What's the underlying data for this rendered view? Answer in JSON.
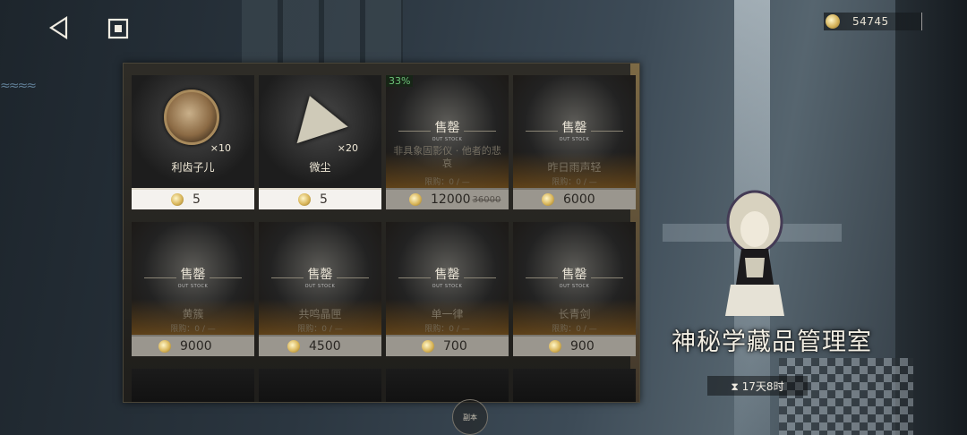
{
  "currency": {
    "amount": "54745",
    "icon": "coin-icon"
  },
  "shop": {
    "row1": [
      {
        "name": "利齿子儿",
        "qty": "×10",
        "price": "5",
        "sold_out": false
      },
      {
        "name": "微尘",
        "qty": "×20",
        "price": "5",
        "sold_out": false
      },
      {
        "name": "非具象固影仪 · 他者的悲哀",
        "price": "12000",
        "old_price": "36000",
        "discount": "33%",
        "limit": "限购：0 / —",
        "sold_out": true
      },
      {
        "name": "昨日雨声轻",
        "price": "6000",
        "limit": "限购：0 / —",
        "sold_out": true
      }
    ],
    "row2": [
      {
        "name": "黄簇",
        "price": "9000",
        "limit": "限购：0 / —",
        "sold_out": true
      },
      {
        "name": "共鸣晶匣",
        "price": "4500",
        "limit": "限购：0 / —",
        "sold_out": true
      },
      {
        "name": "单一律",
        "price": "700",
        "limit": "限购：0 / —",
        "sold_out": true
      },
      {
        "name": "长青剑",
        "price": "900",
        "limit": "限购：0 / —",
        "sold_out": true
      }
    ],
    "sold_label": "售罄",
    "sold_sub": "OUT STOCK"
  },
  "bottom": {
    "label": "副本"
  },
  "title": "神秘学藏品管理室",
  "timer": "⧗ 17天8时"
}
